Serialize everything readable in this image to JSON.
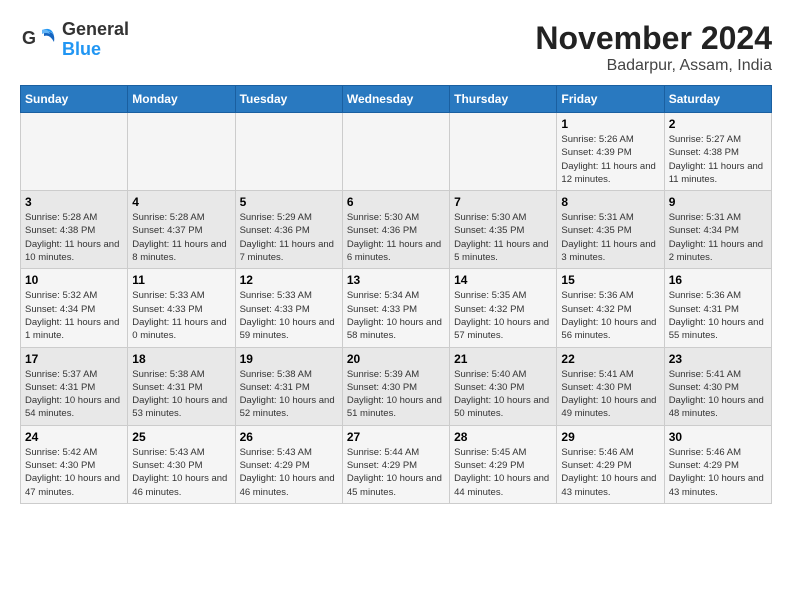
{
  "logo": {
    "general": "General",
    "blue": "Blue"
  },
  "title": "November 2024",
  "subtitle": "Badarpur, Assam, India",
  "days_of_week": [
    "Sunday",
    "Monday",
    "Tuesday",
    "Wednesday",
    "Thursday",
    "Friday",
    "Saturday"
  ],
  "weeks": [
    [
      {
        "day": "",
        "detail": ""
      },
      {
        "day": "",
        "detail": ""
      },
      {
        "day": "",
        "detail": ""
      },
      {
        "day": "",
        "detail": ""
      },
      {
        "day": "",
        "detail": ""
      },
      {
        "day": "1",
        "detail": "Sunrise: 5:26 AM\nSunset: 4:39 PM\nDaylight: 11 hours and 12 minutes."
      },
      {
        "day": "2",
        "detail": "Sunrise: 5:27 AM\nSunset: 4:38 PM\nDaylight: 11 hours and 11 minutes."
      }
    ],
    [
      {
        "day": "3",
        "detail": "Sunrise: 5:28 AM\nSunset: 4:38 PM\nDaylight: 11 hours and 10 minutes."
      },
      {
        "day": "4",
        "detail": "Sunrise: 5:28 AM\nSunset: 4:37 PM\nDaylight: 11 hours and 8 minutes."
      },
      {
        "day": "5",
        "detail": "Sunrise: 5:29 AM\nSunset: 4:36 PM\nDaylight: 11 hours and 7 minutes."
      },
      {
        "day": "6",
        "detail": "Sunrise: 5:30 AM\nSunset: 4:36 PM\nDaylight: 11 hours and 6 minutes."
      },
      {
        "day": "7",
        "detail": "Sunrise: 5:30 AM\nSunset: 4:35 PM\nDaylight: 11 hours and 5 minutes."
      },
      {
        "day": "8",
        "detail": "Sunrise: 5:31 AM\nSunset: 4:35 PM\nDaylight: 11 hours and 3 minutes."
      },
      {
        "day": "9",
        "detail": "Sunrise: 5:31 AM\nSunset: 4:34 PM\nDaylight: 11 hours and 2 minutes."
      }
    ],
    [
      {
        "day": "10",
        "detail": "Sunrise: 5:32 AM\nSunset: 4:34 PM\nDaylight: 11 hours and 1 minute."
      },
      {
        "day": "11",
        "detail": "Sunrise: 5:33 AM\nSunset: 4:33 PM\nDaylight: 11 hours and 0 minutes."
      },
      {
        "day": "12",
        "detail": "Sunrise: 5:33 AM\nSunset: 4:33 PM\nDaylight: 10 hours and 59 minutes."
      },
      {
        "day": "13",
        "detail": "Sunrise: 5:34 AM\nSunset: 4:33 PM\nDaylight: 10 hours and 58 minutes."
      },
      {
        "day": "14",
        "detail": "Sunrise: 5:35 AM\nSunset: 4:32 PM\nDaylight: 10 hours and 57 minutes."
      },
      {
        "day": "15",
        "detail": "Sunrise: 5:36 AM\nSunset: 4:32 PM\nDaylight: 10 hours and 56 minutes."
      },
      {
        "day": "16",
        "detail": "Sunrise: 5:36 AM\nSunset: 4:31 PM\nDaylight: 10 hours and 55 minutes."
      }
    ],
    [
      {
        "day": "17",
        "detail": "Sunrise: 5:37 AM\nSunset: 4:31 PM\nDaylight: 10 hours and 54 minutes."
      },
      {
        "day": "18",
        "detail": "Sunrise: 5:38 AM\nSunset: 4:31 PM\nDaylight: 10 hours and 53 minutes."
      },
      {
        "day": "19",
        "detail": "Sunrise: 5:38 AM\nSunset: 4:31 PM\nDaylight: 10 hours and 52 minutes."
      },
      {
        "day": "20",
        "detail": "Sunrise: 5:39 AM\nSunset: 4:30 PM\nDaylight: 10 hours and 51 minutes."
      },
      {
        "day": "21",
        "detail": "Sunrise: 5:40 AM\nSunset: 4:30 PM\nDaylight: 10 hours and 50 minutes."
      },
      {
        "day": "22",
        "detail": "Sunrise: 5:41 AM\nSunset: 4:30 PM\nDaylight: 10 hours and 49 minutes."
      },
      {
        "day": "23",
        "detail": "Sunrise: 5:41 AM\nSunset: 4:30 PM\nDaylight: 10 hours and 48 minutes."
      }
    ],
    [
      {
        "day": "24",
        "detail": "Sunrise: 5:42 AM\nSunset: 4:30 PM\nDaylight: 10 hours and 47 minutes."
      },
      {
        "day": "25",
        "detail": "Sunrise: 5:43 AM\nSunset: 4:30 PM\nDaylight: 10 hours and 46 minutes."
      },
      {
        "day": "26",
        "detail": "Sunrise: 5:43 AM\nSunset: 4:29 PM\nDaylight: 10 hours and 46 minutes."
      },
      {
        "day": "27",
        "detail": "Sunrise: 5:44 AM\nSunset: 4:29 PM\nDaylight: 10 hours and 45 minutes."
      },
      {
        "day": "28",
        "detail": "Sunrise: 5:45 AM\nSunset: 4:29 PM\nDaylight: 10 hours and 44 minutes."
      },
      {
        "day": "29",
        "detail": "Sunrise: 5:46 AM\nSunset: 4:29 PM\nDaylight: 10 hours and 43 minutes."
      },
      {
        "day": "30",
        "detail": "Sunrise: 5:46 AM\nSunset: 4:29 PM\nDaylight: 10 hours and 43 minutes."
      }
    ]
  ]
}
